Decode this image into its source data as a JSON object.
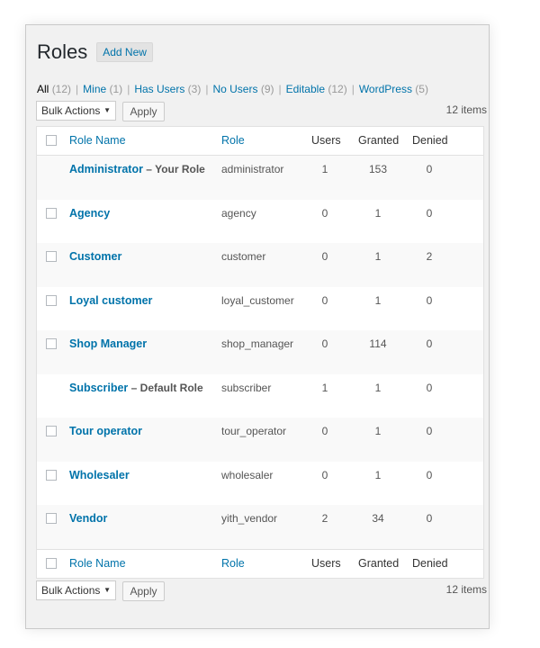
{
  "header": {
    "title": "Roles",
    "add_new_label": "Add New"
  },
  "filters": [
    {
      "label": "All",
      "count": "(12)",
      "current": true
    },
    {
      "label": "Mine",
      "count": "(1)",
      "current": false
    },
    {
      "label": "Has Users",
      "count": "(3)",
      "current": false
    },
    {
      "label": "No Users",
      "count": "(9)",
      "current": false
    },
    {
      "label": "Editable",
      "count": "(12)",
      "current": false
    },
    {
      "label": "WordPress",
      "count": "(5)",
      "current": false
    }
  ],
  "tablenav": {
    "bulk_actions_label": "Bulk Actions",
    "apply_label": "Apply",
    "items_count": "12 items"
  },
  "columns": {
    "role_name": "Role Name",
    "role": "Role",
    "users": "Users",
    "granted": "Granted",
    "denied": "Denied"
  },
  "rows": [
    {
      "name": "Administrator",
      "suffix": " – Your Role",
      "slug": "administrator",
      "users": "1",
      "granted": "153",
      "denied": "0",
      "checkbox": false
    },
    {
      "name": "Agency",
      "suffix": "",
      "slug": "agency",
      "users": "0",
      "granted": "1",
      "denied": "0",
      "checkbox": true
    },
    {
      "name": "Customer",
      "suffix": "",
      "slug": "customer",
      "users": "0",
      "granted": "1",
      "denied": "2",
      "checkbox": true
    },
    {
      "name": "Loyal customer",
      "suffix": "",
      "slug": "loyal_customer",
      "users": "0",
      "granted": "1",
      "denied": "0",
      "checkbox": true
    },
    {
      "name": "Shop Manager",
      "suffix": "",
      "slug": "shop_manager",
      "users": "0",
      "granted": "114",
      "denied": "0",
      "checkbox": true
    },
    {
      "name": "Subscriber",
      "suffix": " – Default Role",
      "slug": "subscriber",
      "users": "1",
      "granted": "1",
      "denied": "0",
      "checkbox": false
    },
    {
      "name": "Tour operator",
      "suffix": "",
      "slug": "tour_operator",
      "users": "0",
      "granted": "1",
      "denied": "0",
      "checkbox": true
    },
    {
      "name": "Wholesaler",
      "suffix": "",
      "slug": "wholesaler",
      "users": "0",
      "granted": "1",
      "denied": "0",
      "checkbox": true
    },
    {
      "name": "Vendor",
      "suffix": "",
      "slug": "yith_vendor",
      "users": "2",
      "granted": "34",
      "denied": "0",
      "checkbox": true
    }
  ],
  "colors": {
    "link": "#0073aa",
    "panel_bg": "#f1f1f1",
    "row_alt": "#f9f9f9"
  },
  "icons": {
    "bulk_select_caret": "caret-down-icon"
  }
}
